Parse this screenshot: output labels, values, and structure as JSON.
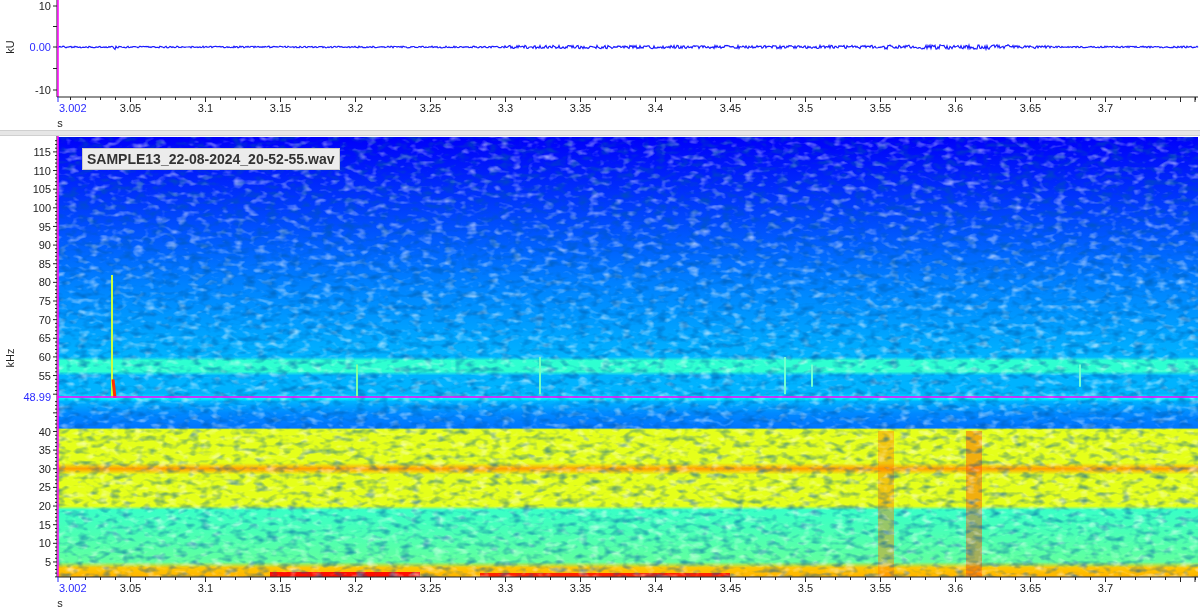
{
  "waveform_panel": {
    "y_unit": "kU",
    "y_ticks": [
      "10",
      "-10"
    ],
    "cursor_readout": "0.00",
    "x_cursor_readout": "3.002",
    "x_ticks": [
      "3.05",
      "3.1",
      "3.15",
      "3.2",
      "3.25",
      "3.3",
      "3.35",
      "3.4",
      "3.45",
      "3.5",
      "3.55",
      "3.6",
      "3.65",
      "3.7"
    ],
    "x_unit": "s"
  },
  "spectrogram_panel": {
    "file_label": "SAMPLE13_22-08-2024_20-52-55.wav",
    "y_unit": "kHz",
    "upper_y_ticks": [
      "115",
      "110",
      "105",
      "100",
      "95",
      "90",
      "85",
      "80",
      "75",
      "70",
      "65",
      "60",
      "55"
    ],
    "lower_y_ticks": [
      "40",
      "35",
      "30",
      "25",
      "20",
      "15",
      "10",
      "5"
    ],
    "cursor_readout": "48.99",
    "x_cursor_readout": "3.002",
    "x_ticks": [
      "3.05",
      "3.1",
      "3.15",
      "3.2",
      "3.25",
      "3.3",
      "3.35",
      "3.4",
      "3.45",
      "3.5",
      "3.55",
      "3.6",
      "3.65",
      "3.7"
    ],
    "x_unit": "s"
  }
}
